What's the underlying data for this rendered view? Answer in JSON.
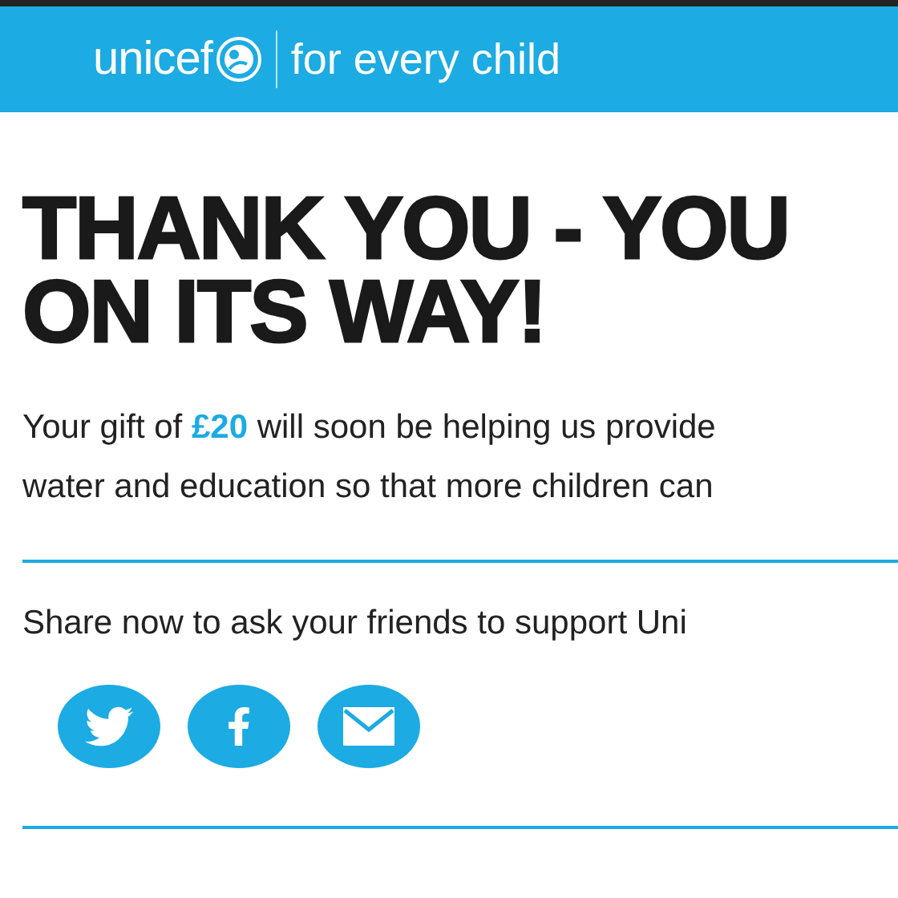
{
  "header": {
    "logo_word": "unicef",
    "tagline": "for every child"
  },
  "title_lines": [
    "THANK YOU - YOU",
    "ON ITS WAY!"
  ],
  "message_lines": [
    "Your gift of **£20** will soon be helping us provide",
    "water and education so that more children can"
  ],
  "share": {
    "text": "Share now to ask your friends to support Uni",
    "buttons": [
      {
        "kind": "twitter"
      },
      {
        "kind": "facebook"
      },
      {
        "kind": "email"
      }
    ]
  }
}
